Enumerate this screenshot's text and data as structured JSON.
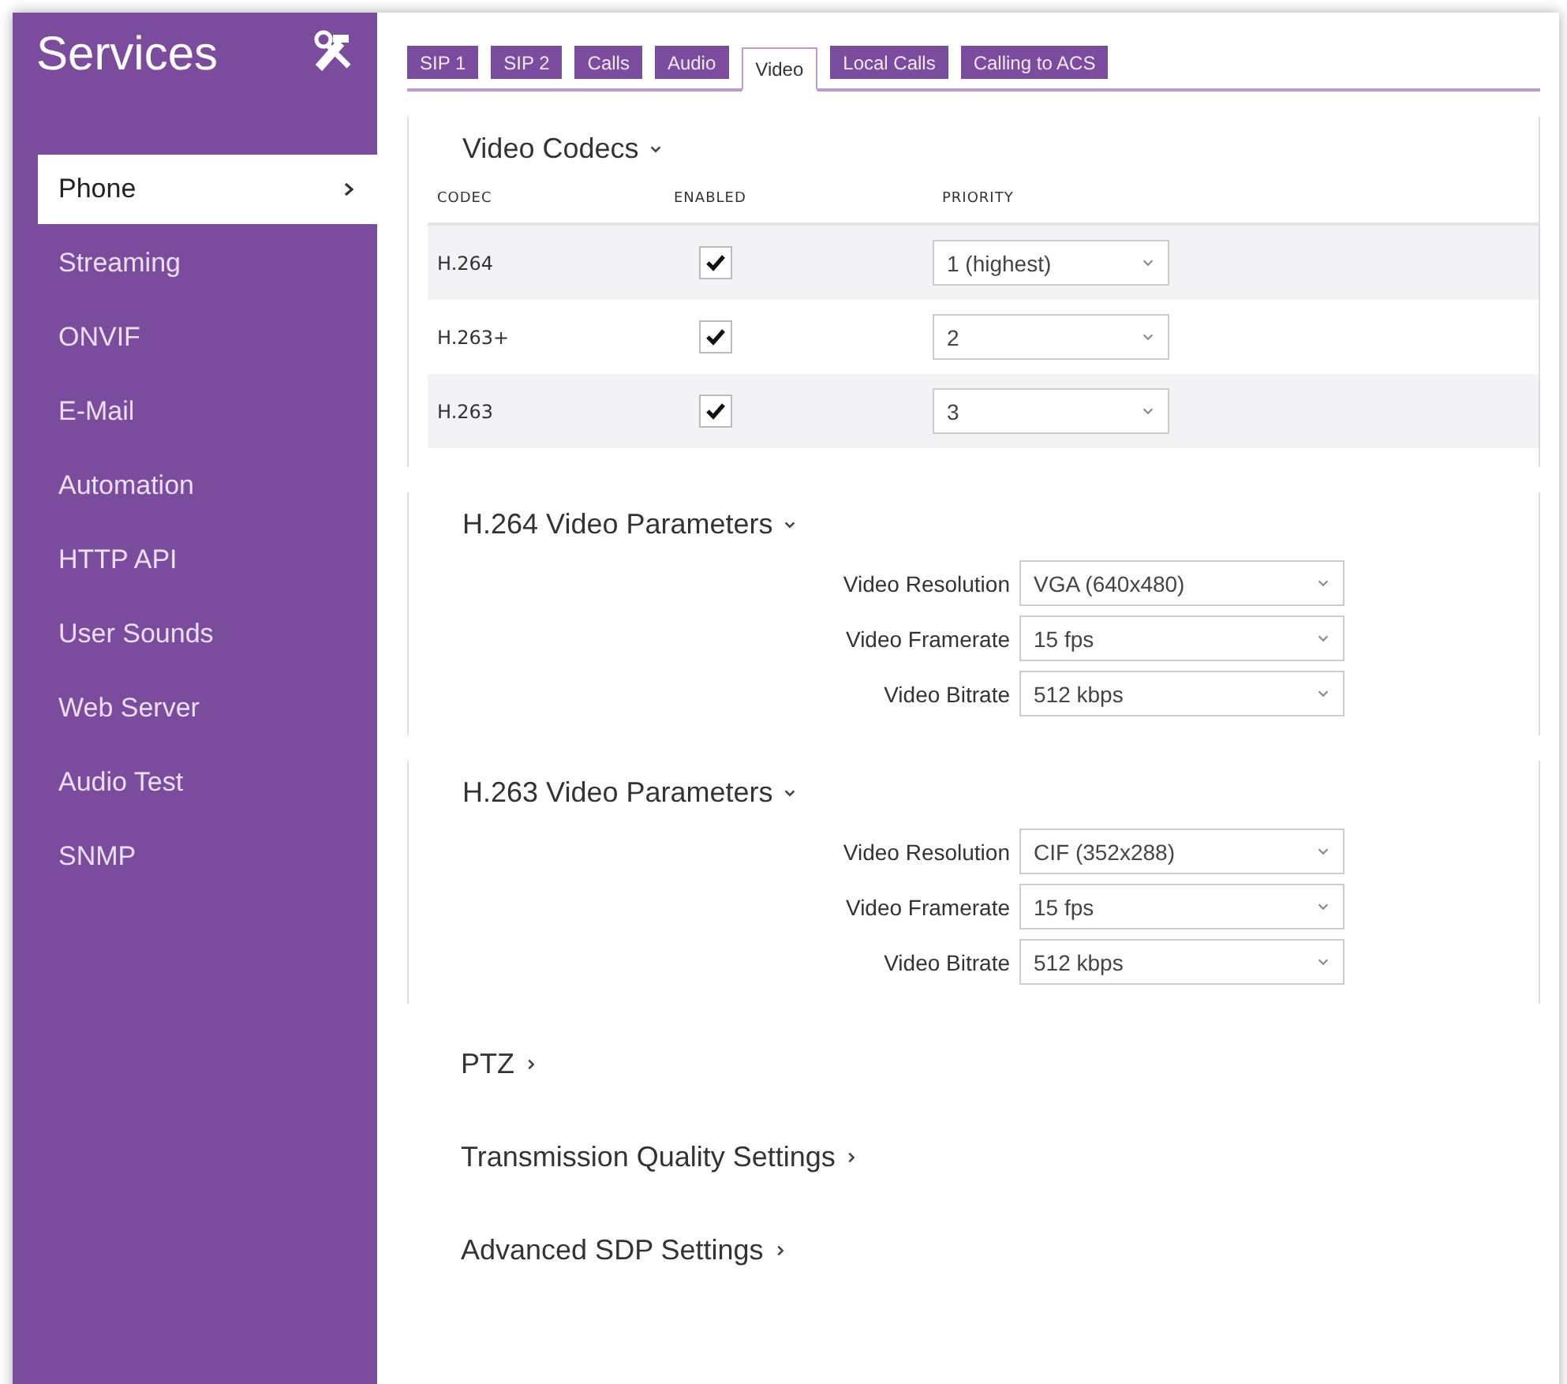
{
  "sidebar": {
    "title": "Services",
    "items": [
      {
        "label": "Phone",
        "selected": true
      },
      {
        "label": "Streaming",
        "selected": false
      },
      {
        "label": "ONVIF",
        "selected": false
      },
      {
        "label": "E-Mail",
        "selected": false
      },
      {
        "label": "Automation",
        "selected": false
      },
      {
        "label": "HTTP API",
        "selected": false
      },
      {
        "label": "User Sounds",
        "selected": false
      },
      {
        "label": "Web Server",
        "selected": false
      },
      {
        "label": "Audio Test",
        "selected": false
      },
      {
        "label": "SNMP",
        "selected": false
      }
    ]
  },
  "tabs": [
    {
      "label": "SIP 1",
      "selected": false
    },
    {
      "label": "SIP 2",
      "selected": false
    },
    {
      "label": "Calls",
      "selected": false
    },
    {
      "label": "Audio",
      "selected": false
    },
    {
      "label": "Video",
      "selected": true
    },
    {
      "label": "Local Calls",
      "selected": false
    },
    {
      "label": "Calling to ACS",
      "selected": false
    }
  ],
  "sections": [
    {
      "kind": "table",
      "title": "Video Codecs",
      "expanded": true,
      "columns": [
        "CODEC",
        "ENABLED",
        "PRIORITY"
      ],
      "rows": [
        {
          "codec": "H.264",
          "enabled": true,
          "priority": "1 (highest)"
        },
        {
          "codec": "H.263+",
          "enabled": true,
          "priority": "2"
        },
        {
          "codec": "H.263",
          "enabled": true,
          "priority": "3"
        }
      ]
    },
    {
      "kind": "form",
      "title": "H.264 Video Parameters",
      "expanded": true,
      "fields": [
        {
          "label": "Video Resolution",
          "value": "VGA (640x480)"
        },
        {
          "label": "Video Framerate",
          "value": "15 fps"
        },
        {
          "label": "Video Bitrate",
          "value": "512 kbps"
        }
      ]
    },
    {
      "kind": "form",
      "title": "H.263 Video Parameters",
      "expanded": true,
      "fields": [
        {
          "label": "Video Resolution",
          "value": "CIF (352x288)"
        },
        {
          "label": "Video Framerate",
          "value": "15 fps"
        },
        {
          "label": "Video Bitrate",
          "value": "512 kbps"
        }
      ]
    },
    {
      "kind": "collapsed",
      "title": "PTZ",
      "expanded": false
    },
    {
      "kind": "collapsed",
      "title": "Transmission Quality Settings",
      "expanded": false
    },
    {
      "kind": "collapsed",
      "title": "Advanced SDP Settings",
      "expanded": false
    }
  ]
}
